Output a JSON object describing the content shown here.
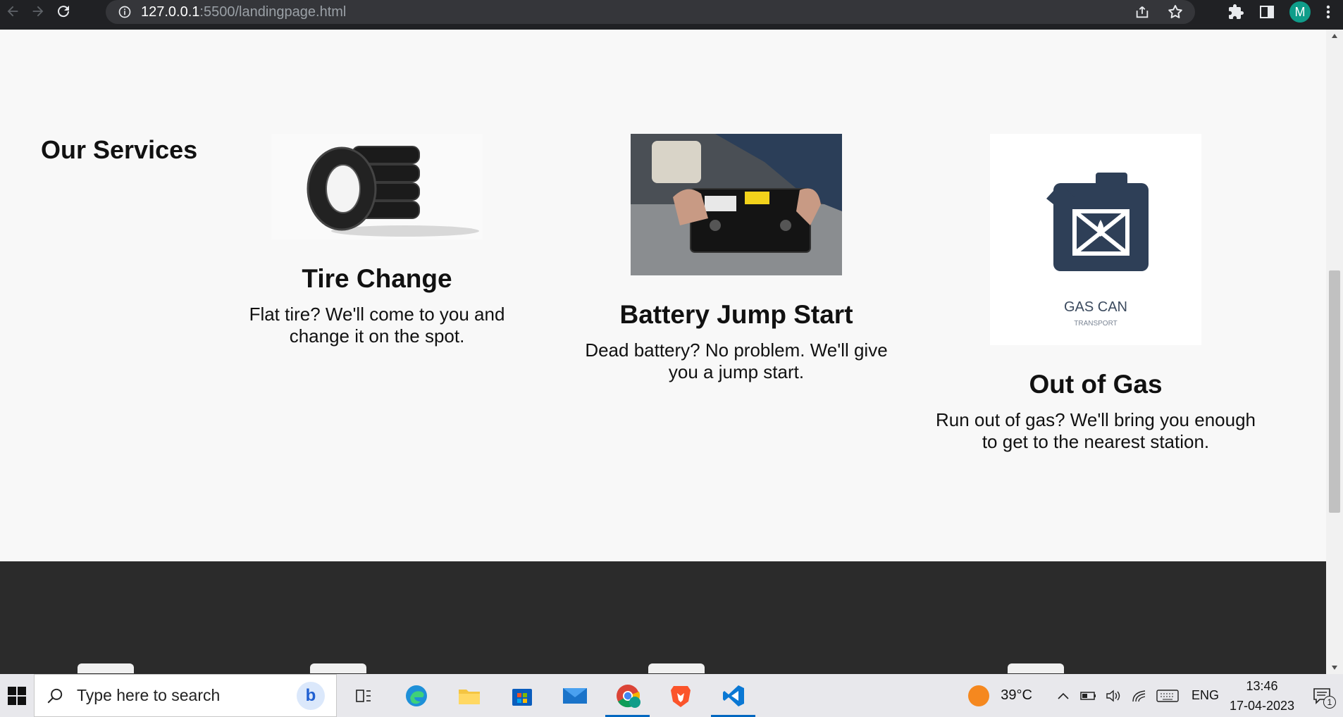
{
  "browser": {
    "url_host": "127.0.0.1",
    "url_rest": ":5500/landingpage.html",
    "profile_initial": "M"
  },
  "page": {
    "services_heading": "Our Services",
    "services": [
      {
        "title": "Tire Change",
        "description": "Flat tire? We'll come to you and change it on the spot.",
        "image": "tires-image"
      },
      {
        "title": "Battery Jump Start",
        "description": "Dead battery? No problem. We'll give you a jump start.",
        "image": "battery-image"
      },
      {
        "title": "Out of Gas",
        "description": "Run out of gas? We'll bring you enough to get to the nearest station.",
        "image": "gas-can-image",
        "image_text": "GAS CAN",
        "image_subtext": "TRANSPORT"
      }
    ]
  },
  "taskbar": {
    "search_placeholder": "Type here to search",
    "weather": "39°C",
    "language": "ENG",
    "time": "13:46",
    "date": "17-04-2023",
    "notifications": "1"
  }
}
